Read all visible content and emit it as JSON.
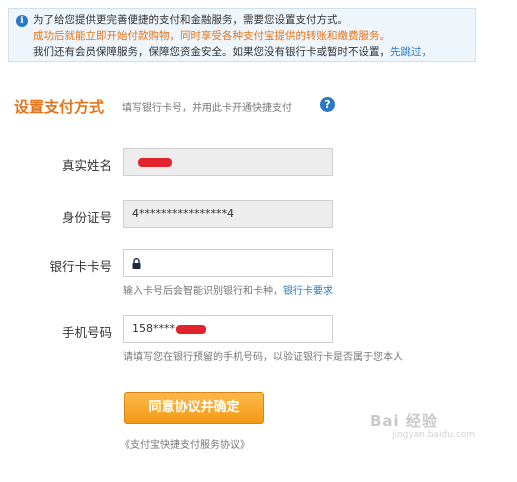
{
  "notice": {
    "line1": "为了给您提供更完善便捷的支付和金融服务，需要您设置支付方式。",
    "line2": "成功后就能立即开始付款购物，同时享受各种支付宝提供的转账和缴费服务。",
    "line3_prefix": "我们还有会员保障服务，保障您资金安全。如果您没有银行卡或暂时不设置，",
    "skip_link": "先跳过，"
  },
  "section": {
    "title": "设置支付方式",
    "subtitle": "填写银行卡号，并用此卡开通快捷支付"
  },
  "form": {
    "name_label": "真实姓名",
    "id_label": "身份证号",
    "id_value": "4****************4",
    "card_label": "银行卡卡号",
    "card_hint": "输入卡号后会智能识别银行和卡种，",
    "card_hint_link": "银行卡要求",
    "phone_label": "手机号码",
    "phone_value": "158****",
    "phone_hint": "请填写您在银行预留的手机号码，以验证银行卡是否属于您本人"
  },
  "submit_label": "同意协议并确定",
  "agreement_text": "《支付宝快捷支付服务协议》",
  "watermark": "Bai 经验",
  "watermark_sub": "jingyan.baidu.com",
  "colors": {
    "accent": "#e4741a",
    "link": "#2b79c2",
    "button": "#f39b14",
    "redaction": "#e3232c"
  }
}
